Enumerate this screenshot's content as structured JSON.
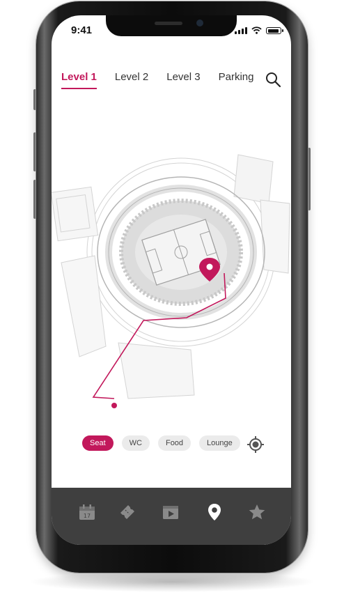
{
  "status": {
    "time": "9:41"
  },
  "levels": {
    "tabs": [
      {
        "label": "Level 1",
        "active": true
      },
      {
        "label": "Level 2",
        "active": false
      },
      {
        "label": "Level 3",
        "active": false
      },
      {
        "label": "Parking",
        "active": false
      }
    ]
  },
  "filters": {
    "chips": [
      {
        "label": "Seat",
        "active": true
      },
      {
        "label": "WC",
        "active": false
      },
      {
        "label": "Food",
        "active": false
      },
      {
        "label": "Lounge",
        "active": false
      }
    ]
  },
  "calendar_day": "17",
  "colors": {
    "accent": "#c2185b",
    "tabbar": "#3f3f3f",
    "chip": "#ebebeb"
  },
  "icons": {
    "search": "search-icon",
    "locate": "locate-icon",
    "nav": [
      "calendar-icon",
      "ticket-icon",
      "video-icon",
      "map-pin-icon",
      "star-icon"
    ]
  }
}
